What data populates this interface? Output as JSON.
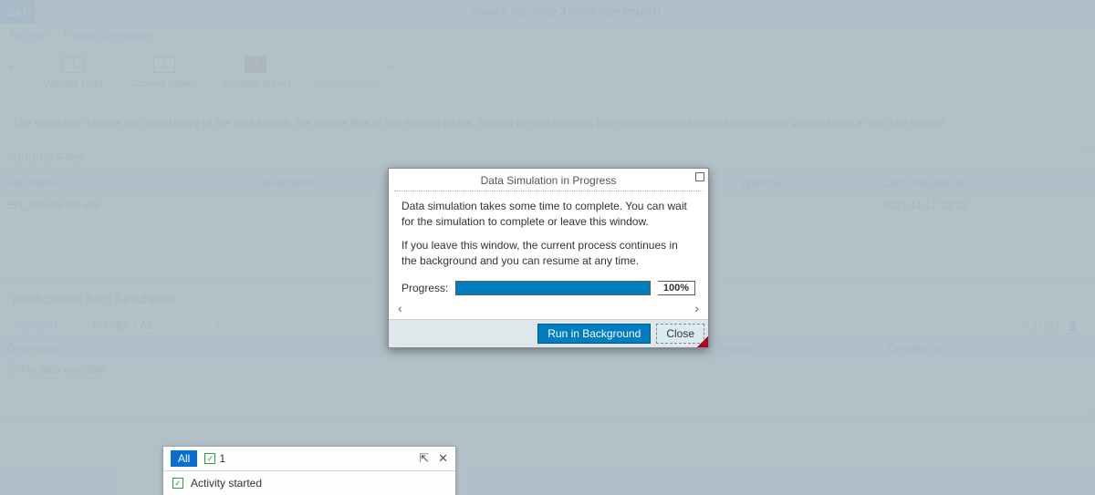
{
  "header": {
    "logo": "SAP",
    "title": "Source list: Step 3  (Simulate Import)"
  },
  "actions": {
    "refresh": "Refresh",
    "repeat": "Repeat Simulation"
  },
  "wizard": {
    "steps": [
      {
        "num": "1",
        "label": "Validate Data"
      },
      {
        "num": "2",
        "label": "Convert Values"
      },
      {
        "num": "3",
        "label": "Simulate Import"
      },
      {
        "num": "4",
        "label": "Execute Import"
      }
    ]
  },
  "instruction": "The simulation checks the consistency of the data source, the source files or the staging tables. Review the notifications from simulation and correct inconsistent values found in the data source.",
  "source_files": {
    "heading": "Source Files",
    "columns": {
      "file_name": "File Name",
      "description": "Description",
      "changed_by": "nged by",
      "last_changed_on": "Last changed on"
    },
    "rows": [
      {
        "file_name": "EN_Source list.xml",
        "description": "",
        "changed_by": "",
        "last_changed_on": "2021.11.17 23:23"
      }
    ]
  },
  "notifications": {
    "heading": "Notifications from Simulation",
    "standard_label": "Standard",
    "priority_label": "Priority:",
    "priority_value": "All",
    "columns": {
      "description": "Description",
      "priority": "Priority",
      "created_on": "Created on"
    },
    "no_data": "No data available"
  },
  "messages": {
    "all_label": "All",
    "count": "1",
    "activity": "Activity started"
  },
  "modal": {
    "title": "Data Simulation in Progress",
    "line1": "Data simulation takes some time to complete. You can wait for the simulation to complete or leave this window.",
    "line2": "If you leave this window, the current process continues in the background and you can resume at any time.",
    "progress_label": "Progress:",
    "progress_pct": "100%",
    "run_bg": "Run in Background",
    "close": "Close"
  }
}
